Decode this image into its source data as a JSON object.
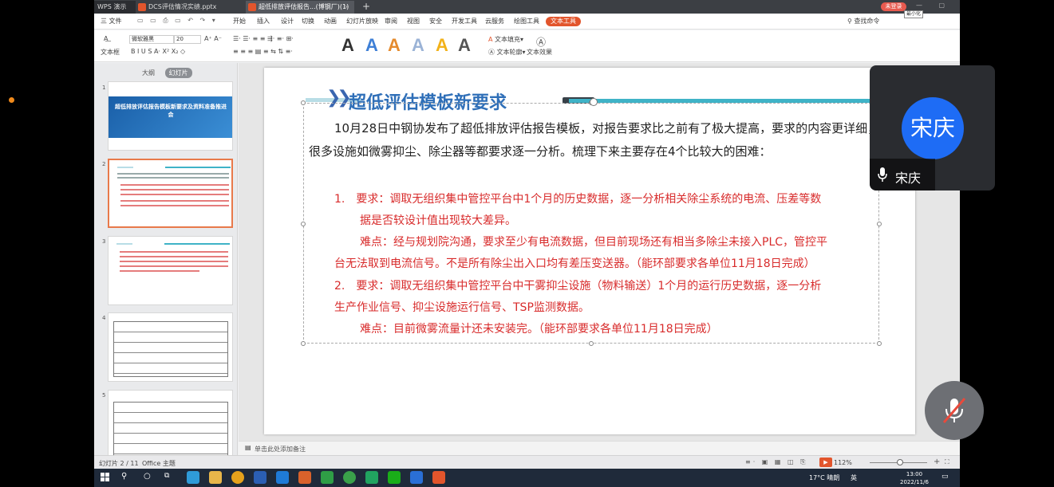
{
  "taskbar_app_title": "WPS 演示",
  "tabs": [
    {
      "label": "DCS评估情况实绩.pptx"
    },
    {
      "label": "超低排放评估报告...(博钢厂)(1)"
    }
  ],
  "login_button": "未登录",
  "tooltip": "最小化",
  "menu": {
    "file": "三 文件",
    "items": [
      "开始",
      "插入",
      "设计",
      "切换",
      "动画",
      "幻灯片放映",
      "审阅",
      "视图",
      "安全",
      "开发工具",
      "云服务",
      "绘图工具"
    ],
    "active": "文本工具",
    "search": "查找命令"
  },
  "toolbar": {
    "textbox_label": "文本框",
    "font_name": "微软雅黑",
    "font_size": "20",
    "text_fill": "文本填充",
    "text_outline": "文本轮廓",
    "text_effect": "文本效果",
    "style_letters": [
      "A",
      "A",
      "A",
      "A",
      "A",
      "A"
    ],
    "style_colors": [
      "#111111",
      "#3e7fd6",
      "#e58b2e",
      "#9bb3d6",
      "#f2b21a",
      "#555555"
    ]
  },
  "left_pane": {
    "tab_outline": "大纲",
    "tab_slides": "幻灯片",
    "slide_numbers": [
      "1",
      "2",
      "3",
      "4",
      "5"
    ],
    "thumb1_title": "超低排放评估报告模板新要求及资料准备推进会"
  },
  "slide": {
    "title": "超低评估模板新要求",
    "intro": "10月28日中钢协发布了超低排放评估报告模板，对报告要求比之前有了极大提高，要求的内容更详细，很多设施如微雾抑尘、除尘器等都要求逐一分析。梳理下来主要存在4个比较大的困难：",
    "req1": "1.　要求：调取无组织集中管控平台中1个月的历史数据，逐一分析相关除尘系统的电流、压差等数",
    "req1b": "据是否较设计值出现较大差异。",
    "diff1": "难点：经与规划院沟通，要求至少有电流数据，但目前现场还有相当多除尘未接入PLC，管控平",
    "diff1b": "台无法取到电流信号。不是所有除尘出入口均有差压变送器。（能环部要求各单位11月18日完成）",
    "req2": "2.　要求：调取无组织集中管控平台中干雾抑尘设施（物料输送）1个月的运行历史数据，逐一分析",
    "req2b": "生产作业信号、抑尘设施运行信号、TSP监测数据。",
    "diff2": "难点：目前微雾流量计还未安装完。（能环部要求各单位11月18日完成）"
  },
  "notes_placeholder": "单击此处添加备注",
  "status": {
    "slide_count": "幻灯片 2 / 11",
    "theme": "Office 主题",
    "zoom": "112%"
  },
  "meeting": {
    "avatar_text": "宋庆",
    "speaker_name": "宋庆"
  },
  "system_tray": {
    "weather": "17°C 晴朗",
    "ime": "英",
    "time": "13:00",
    "date": "2022/11/6"
  },
  "colors": {
    "accent_orange": "#e2552c",
    "title_blue": "#2f6fb8",
    "body_red": "#d82b2b",
    "meeting_blue": "#1e6cf5"
  }
}
